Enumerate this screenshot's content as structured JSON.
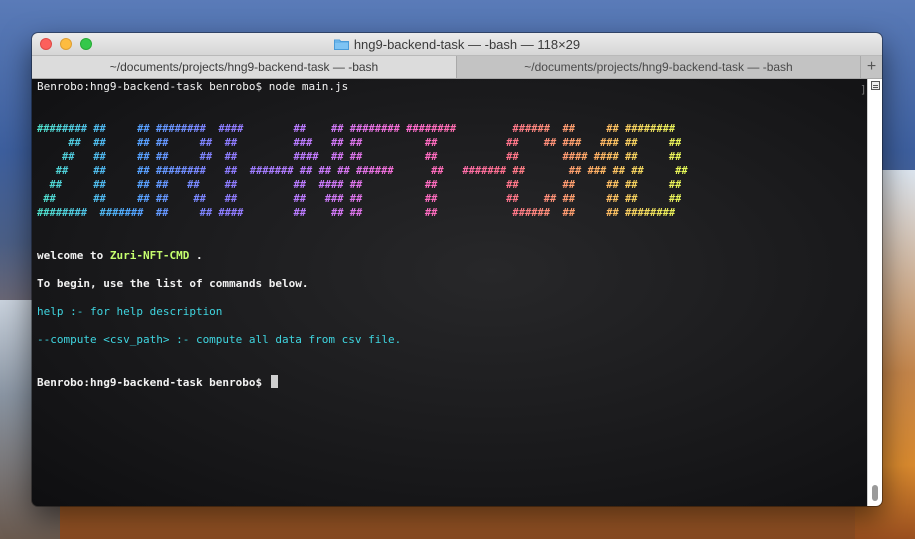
{
  "window": {
    "title": "hng9-backend-task — -bash — 118×29",
    "title_icon": "folder-icon"
  },
  "tabs": [
    {
      "label": "~/documents/projects/hng9-backend-task — -bash"
    },
    {
      "label": "~/documents/projects/hng9-backend-task — -bash"
    }
  ],
  "tab_add_label": "+",
  "terminal": {
    "prompt1": "Benrobo:hng9-backend-task benrobo$ node main.js",
    "ascii_art": [
      "######## ##     ## ########  ####        ##    ## ######## ########         ######  ##     ## ########",
      "     ##  ##     ## ##     ##  ##         ###   ## ##          ##           ##    ## ###   ### ##     ##",
      "    ##   ##     ## ##     ##  ##         ####  ## ##          ##           ##       #### #### ##     ##",
      "   ##    ##     ## ########   ##  ####### ## ## ## ######      ##   ####### ##       ## ### ## ##     ##",
      "  ##     ##     ## ##   ##    ##         ##  #### ##          ##           ##       ##     ## ##     ##",
      " ##      ##     ## ##    ##   ##         ##   ### ##          ##           ##    ## ##     ## ##     ##",
      "########  #######  ##     ## ####        ##    ## ##          ##            ######  ##     ## ########"
    ],
    "welcome_prefix": "welcome to ",
    "welcome_name": "Zuri-NFT-CMD",
    "welcome_suffix": " .",
    "begin_text": "To begin, use the list of commands below.",
    "help_line": "help :- for help description",
    "compute_line": "--compute <csv_path> :- compute all data from csv file.",
    "prompt2": "Benrobo:hng9-backend-task benrobo$",
    "right_bracket": "]"
  },
  "colors": {
    "help": "#3fd5e0",
    "welcome_name": "#c6ff6e",
    "rainbow": [
      "#4fe0c8",
      "#4fa6ff",
      "#8a7cff",
      "#c57bff",
      "#ff6bd0",
      "#ff6f8e",
      "#ffb064",
      "#e6ff57",
      "#a6ff5c"
    ]
  }
}
